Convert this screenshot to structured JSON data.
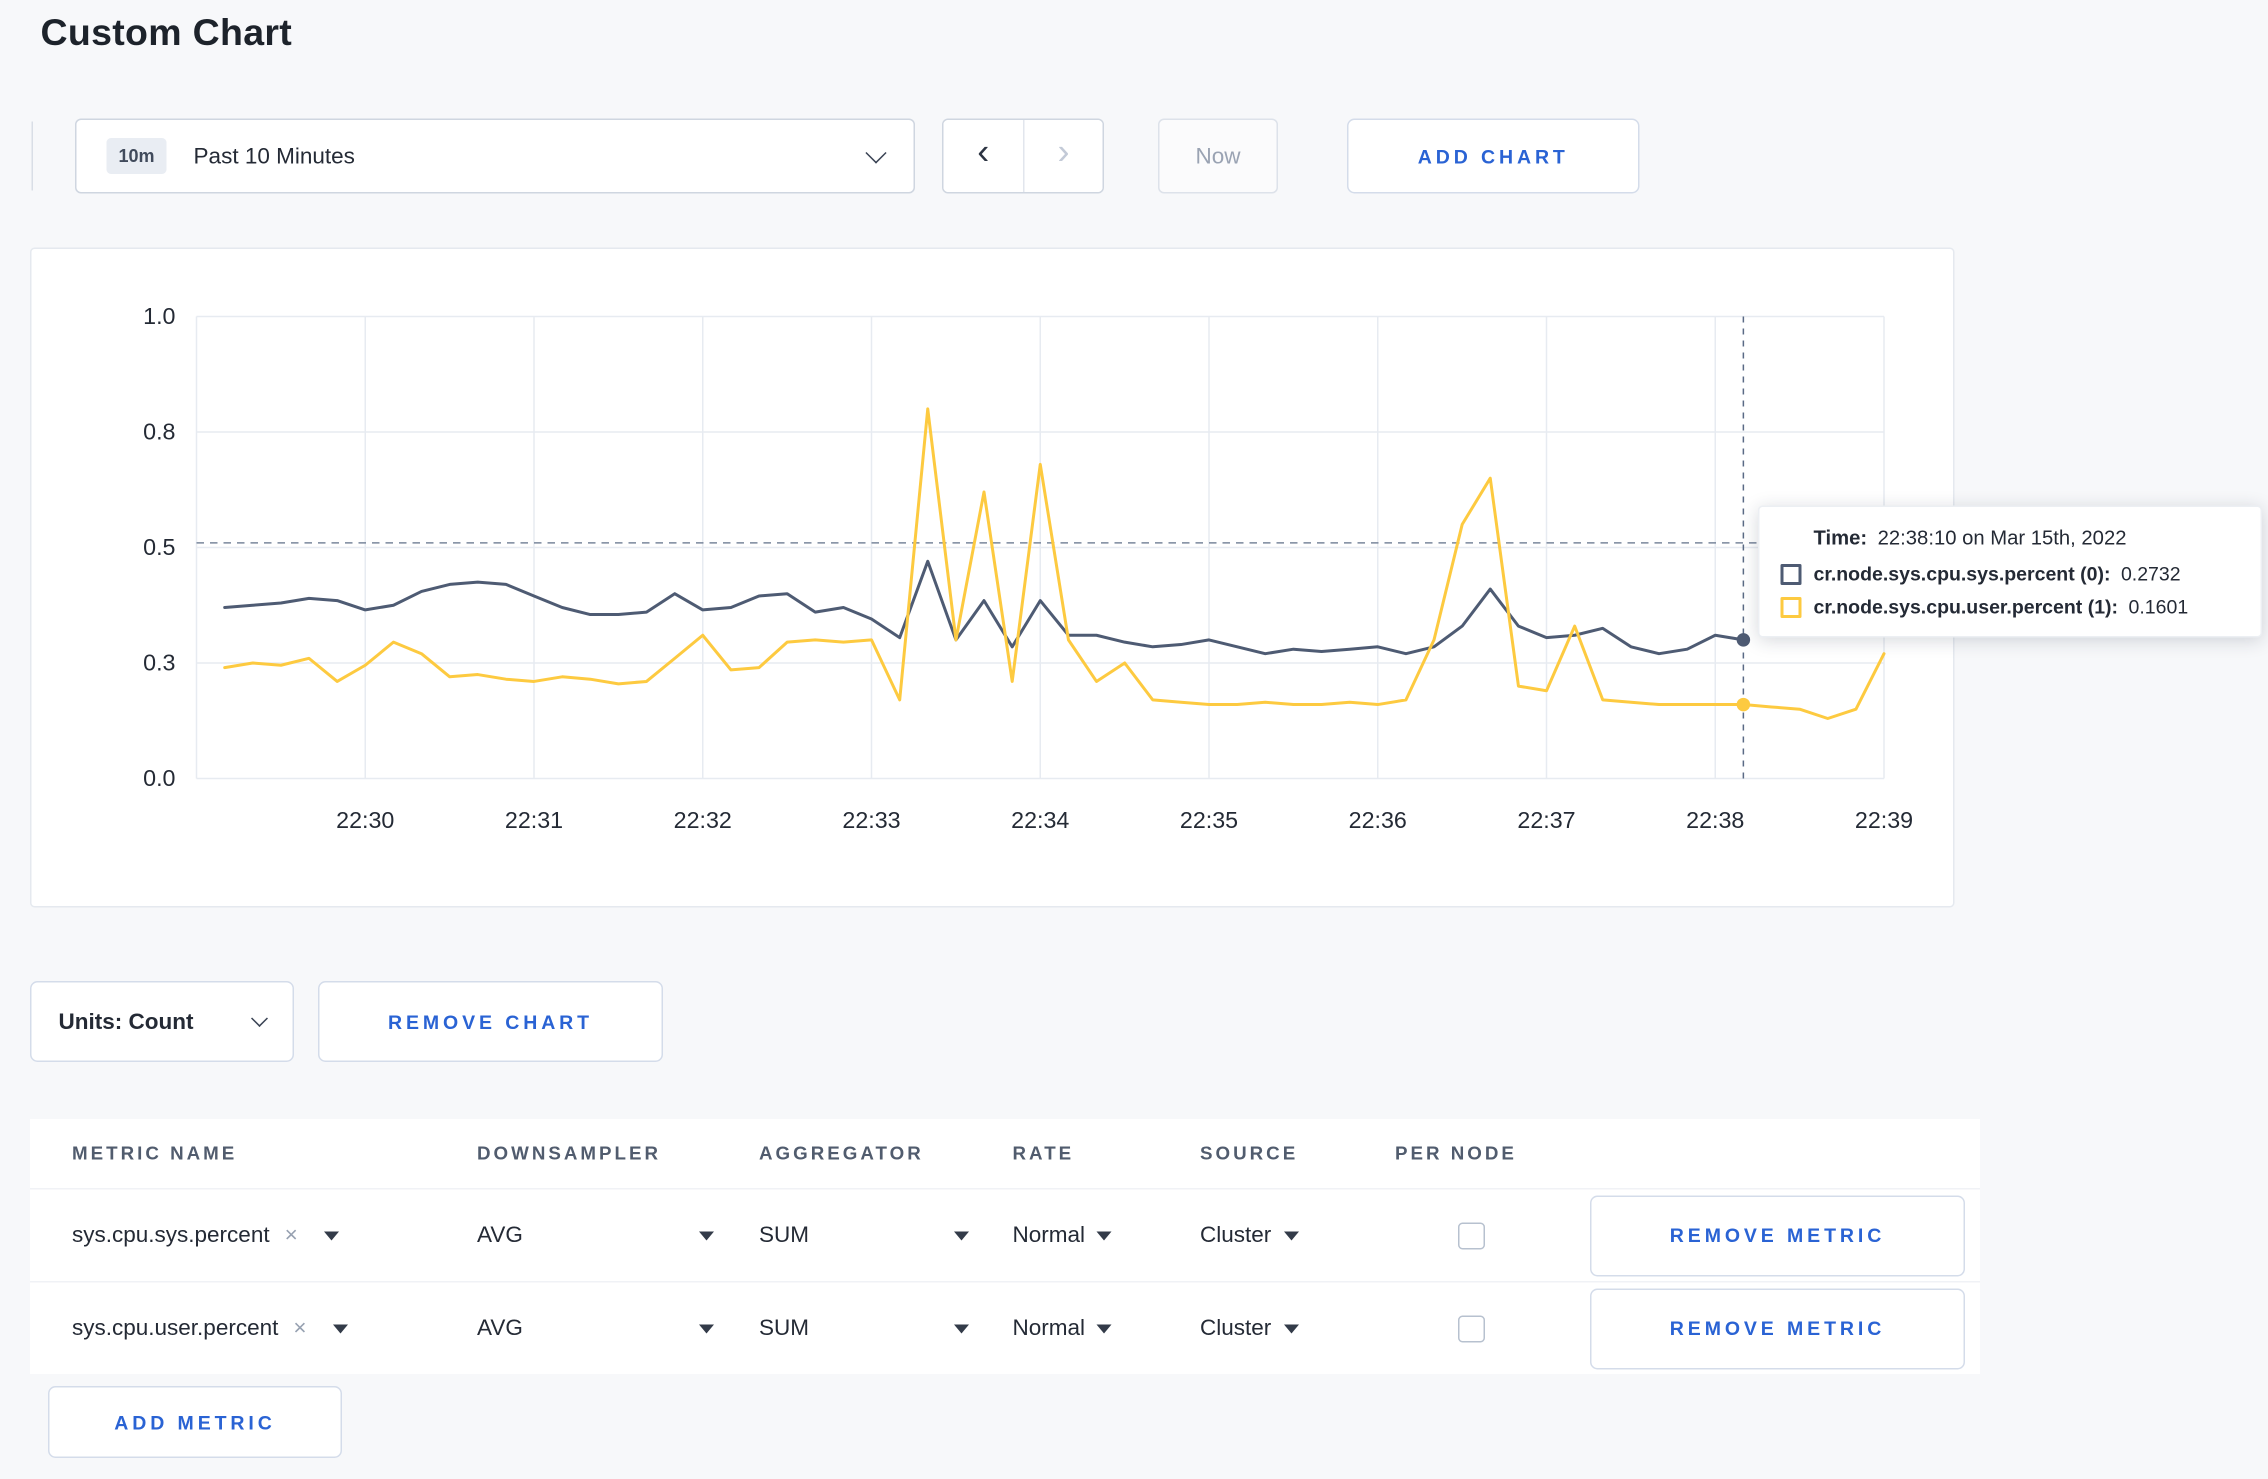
{
  "colors": {
    "accent": "#2a63d4",
    "series_sys": "#4e5b73",
    "series_user": "#fdca40",
    "grid": "#e7ebf1",
    "text_dark": "#242a35"
  },
  "page": {
    "title": "Custom Chart"
  },
  "toolbar": {
    "time_badge": "10m",
    "time_label": "Past 10 Minutes",
    "back": "‹",
    "forward": "›",
    "now": "Now",
    "add_chart": "ADD CHART"
  },
  "controls": {
    "units": "Units: Count",
    "remove_chart": "REMOVE CHART",
    "add_metric": "ADD METRIC"
  },
  "tooltip": {
    "time_label": "Time:",
    "time_value": "22:38:10 on Mar 15th, 2022",
    "rows": [
      {
        "label": "cr.node.sys.cpu.sys.percent (0):",
        "value": "0.2732",
        "color": "#4e5b73"
      },
      {
        "label": "cr.node.sys.cpu.user.percent (1):",
        "value": "0.1601",
        "color": "#fdca40"
      }
    ]
  },
  "metrics_table": {
    "headers": [
      "METRIC NAME",
      "DOWNSAMPLER",
      "AGGREGATOR",
      "RATE",
      "SOURCE",
      "PER NODE"
    ],
    "rows": [
      {
        "metric": "sys.cpu.sys.percent",
        "remove_value": "×",
        "downsampler": "AVG",
        "aggregator": "SUM",
        "rate": "Normal",
        "source": "Cluster",
        "per_node_checked": false,
        "remove_metric": "REMOVE METRIC"
      },
      {
        "metric": "sys.cpu.user.percent",
        "remove_value": "×",
        "downsampler": "AVG",
        "aggregator": "SUM",
        "rate": "Normal",
        "source": "Cluster",
        "per_node_checked": false,
        "remove_metric": "REMOVE METRIC"
      }
    ]
  },
  "chart_data": {
    "type": "line",
    "title": "",
    "xlabel": "",
    "ylabel": "",
    "ylim": [
      0,
      1.0
    ],
    "x_domain_seconds": [
      0,
      600
    ],
    "grid": true,
    "legend": "none",
    "y_ticks": [
      {
        "v": 0.0,
        "label": "0.0"
      },
      {
        "v": 0.25,
        "label": "0.3"
      },
      {
        "v": 0.5,
        "label": "0.5"
      },
      {
        "v": 0.75,
        "label": "0.8"
      },
      {
        "v": 1.0,
        "label": "1.0"
      }
    ],
    "x_ticks": [
      {
        "t": 60,
        "label": "22:30"
      },
      {
        "t": 120,
        "label": "22:31"
      },
      {
        "t": 180,
        "label": "22:32"
      },
      {
        "t": 240,
        "label": "22:33"
      },
      {
        "t": 300,
        "label": "22:34"
      },
      {
        "t": 360,
        "label": "22:35"
      },
      {
        "t": 420,
        "label": "22:36"
      },
      {
        "t": 480,
        "label": "22:37"
      },
      {
        "t": 540,
        "label": "22:38"
      },
      {
        "t": 600,
        "label": "22:39"
      }
    ],
    "guideline_y": 0.51,
    "crosshair_t": 550,
    "series": [
      {
        "name": "cr.node.sys.cpu.sys.percent",
        "color": "#4e5b73",
        "marker": [
          550,
          0.3
        ],
        "points": [
          [
            10,
            0.37
          ],
          [
            20,
            0.375
          ],
          [
            30,
            0.38
          ],
          [
            40,
            0.39
          ],
          [
            50,
            0.385
          ],
          [
            60,
            0.365
          ],
          [
            70,
            0.375
          ],
          [
            80,
            0.405
          ],
          [
            90,
            0.42
          ],
          [
            100,
            0.425
          ],
          [
            110,
            0.42
          ],
          [
            120,
            0.395
          ],
          [
            130,
            0.37
          ],
          [
            140,
            0.355
          ],
          [
            150,
            0.355
          ],
          [
            160,
            0.36
          ],
          [
            170,
            0.4
          ],
          [
            180,
            0.365
          ],
          [
            190,
            0.37
          ],
          [
            200,
            0.395
          ],
          [
            210,
            0.4
          ],
          [
            220,
            0.36
          ],
          [
            230,
            0.37
          ],
          [
            240,
            0.345
          ],
          [
            250,
            0.305
          ],
          [
            260,
            0.47
          ],
          [
            270,
            0.3
          ],
          [
            280,
            0.385
          ],
          [
            290,
            0.285
          ],
          [
            300,
            0.385
          ],
          [
            310,
            0.31
          ],
          [
            320,
            0.31
          ],
          [
            330,
            0.295
          ],
          [
            340,
            0.285
          ],
          [
            350,
            0.29
          ],
          [
            360,
            0.3
          ],
          [
            370,
            0.285
          ],
          [
            380,
            0.27
          ],
          [
            390,
            0.28
          ],
          [
            400,
            0.275
          ],
          [
            410,
            0.28
          ],
          [
            420,
            0.285
          ],
          [
            430,
            0.27
          ],
          [
            440,
            0.285
          ],
          [
            450,
            0.33
          ],
          [
            460,
            0.41
          ],
          [
            470,
            0.33
          ],
          [
            480,
            0.305
          ],
          [
            490,
            0.31
          ],
          [
            500,
            0.325
          ],
          [
            510,
            0.285
          ],
          [
            520,
            0.27
          ],
          [
            530,
            0.28
          ],
          [
            540,
            0.31
          ],
          [
            550,
            0.3
          ]
        ]
      },
      {
        "name": "cr.node.sys.cpu.user.percent",
        "color": "#fdca40",
        "marker": [
          550,
          0.16
        ],
        "points": [
          [
            10,
            0.24
          ],
          [
            20,
            0.25
          ],
          [
            30,
            0.245
          ],
          [
            40,
            0.26
          ],
          [
            50,
            0.21
          ],
          [
            60,
            0.245
          ],
          [
            70,
            0.295
          ],
          [
            80,
            0.27
          ],
          [
            90,
            0.22
          ],
          [
            100,
            0.225
          ],
          [
            110,
            0.215
          ],
          [
            120,
            0.21
          ],
          [
            130,
            0.22
          ],
          [
            140,
            0.215
          ],
          [
            150,
            0.205
          ],
          [
            160,
            0.21
          ],
          [
            170,
            0.26
          ],
          [
            180,
            0.31
          ],
          [
            190,
            0.235
          ],
          [
            200,
            0.24
          ],
          [
            210,
            0.295
          ],
          [
            220,
            0.3
          ],
          [
            230,
            0.295
          ],
          [
            240,
            0.3
          ],
          [
            250,
            0.17
          ],
          [
            260,
            0.8
          ],
          [
            270,
            0.3
          ],
          [
            280,
            0.62
          ],
          [
            290,
            0.21
          ],
          [
            300,
            0.68
          ],
          [
            310,
            0.3
          ],
          [
            320,
            0.21
          ],
          [
            330,
            0.25
          ],
          [
            340,
            0.17
          ],
          [
            350,
            0.165
          ],
          [
            360,
            0.16
          ],
          [
            370,
            0.16
          ],
          [
            380,
            0.165
          ],
          [
            390,
            0.16
          ],
          [
            400,
            0.16
          ],
          [
            410,
            0.165
          ],
          [
            420,
            0.16
          ],
          [
            430,
            0.17
          ],
          [
            440,
            0.3
          ],
          [
            450,
            0.55
          ],
          [
            460,
            0.65
          ],
          [
            470,
            0.2
          ],
          [
            480,
            0.19
          ],
          [
            490,
            0.33
          ],
          [
            500,
            0.17
          ],
          [
            510,
            0.165
          ],
          [
            520,
            0.16
          ],
          [
            530,
            0.16
          ],
          [
            540,
            0.16
          ],
          [
            550,
            0.16
          ],
          [
            560,
            0.155
          ],
          [
            570,
            0.15
          ],
          [
            580,
            0.13
          ],
          [
            590,
            0.15
          ],
          [
            600,
            0.27
          ]
        ]
      }
    ]
  }
}
